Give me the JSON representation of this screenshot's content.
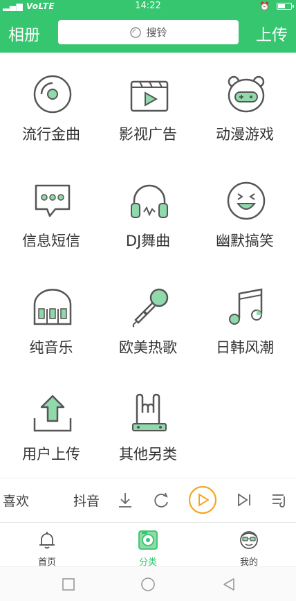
{
  "status_bar": {
    "carrier": "VoLTE",
    "time": "14:22",
    "battery_level": 0.6
  },
  "header": {
    "title": "相册",
    "upload_label": "上传",
    "search_placeholder": "搜铃"
  },
  "categories": [
    {
      "label": "流行金曲",
      "icon": "vinyl-record-icon"
    },
    {
      "label": "影视广告",
      "icon": "video-play-icon"
    },
    {
      "label": "动漫游戏",
      "icon": "game-controller-bear-icon"
    },
    {
      "label": "信息短信",
      "icon": "message-bubble-icon"
    },
    {
      "label": "DJ舞曲",
      "icon": "headphones-icon"
    },
    {
      "label": "幽默搞笑",
      "icon": "laughing-face-icon"
    },
    {
      "label": "纯音乐",
      "icon": "piano-icon"
    },
    {
      "label": "欧美热歌",
      "icon": "microphone-icon"
    },
    {
      "label": "日韩风潮",
      "icon": "music-note-icon"
    },
    {
      "label": "用户上传",
      "icon": "upload-arrow-icon"
    },
    {
      "label": "其他另类",
      "icon": "rock-hand-icon"
    }
  ],
  "player": {
    "scroll_text_1": "喜欢",
    "scroll_text_2": "抖音",
    "icons": [
      "download-icon",
      "repeat-icon",
      "play-icon",
      "next-icon",
      "playlist-icon"
    ]
  },
  "tabs": [
    {
      "label": "首页",
      "icon": "bell-icon",
      "active": false
    },
    {
      "label": "分类",
      "icon": "music-disc-icon",
      "active": true
    },
    {
      "label": "我的",
      "icon": "profile-face-icon",
      "active": false
    }
  ],
  "colors": {
    "brand_green": "#35c66f",
    "icon_green": "#8fd9ab",
    "play_orange": "#f5a623",
    "icon_stroke": "#555555"
  }
}
